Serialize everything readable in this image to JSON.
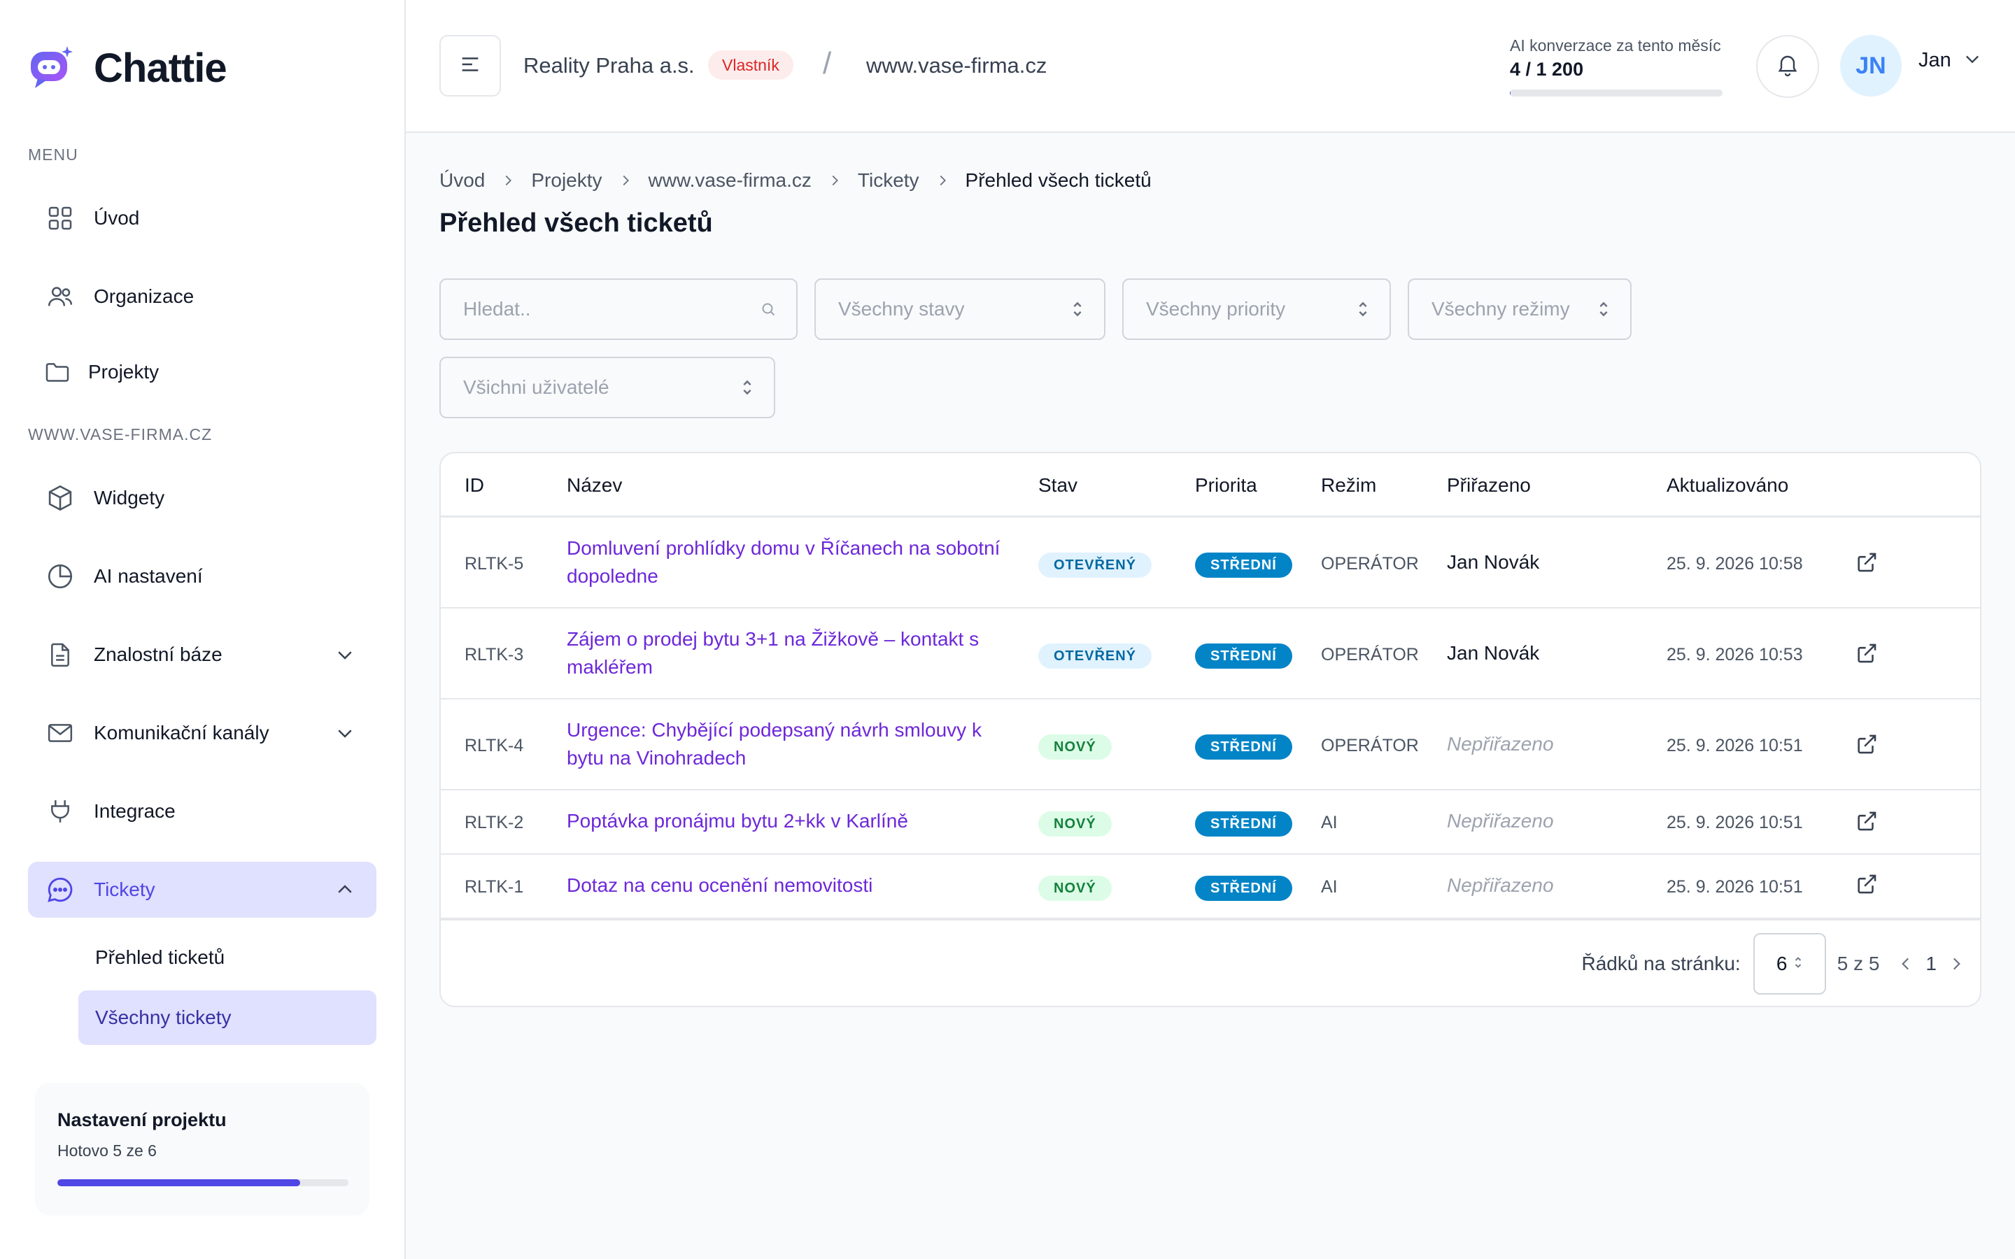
{
  "app": {
    "name": "Chattie"
  },
  "sidebar": {
    "menu_label": "MENU",
    "project_label": "WWW.VASE-FIRMA.CZ",
    "menu_items": [
      {
        "label": "Úvod",
        "icon": "dashboard-icon"
      },
      {
        "label": "Organizace",
        "icon": "users-icon"
      },
      {
        "label": "Projekty",
        "icon": "folder-icon"
      }
    ],
    "project_items": [
      {
        "label": "Widgety",
        "icon": "cube-icon"
      },
      {
        "label": "AI nastavení",
        "icon": "pie-chart-icon"
      },
      {
        "label": "Znalostní báze",
        "icon": "document-icon"
      },
      {
        "label": "Komunikační kanály",
        "icon": "mail-icon"
      },
      {
        "label": "Integrace",
        "icon": "plug-icon"
      },
      {
        "label": "Tickety",
        "icon": "chat-icon"
      }
    ],
    "tickets_sub": [
      {
        "label": "Přehled ticketů"
      },
      {
        "label": "Všechny tickety"
      }
    ],
    "setup": {
      "title": "Nastavení projektu",
      "progress_text": "Hotovo 5 ze 6",
      "progress": 0.833
    }
  },
  "header": {
    "organization": "Reality Praha a.s.",
    "role_badge": "Vlastník",
    "site": "www.vase-firma.cz",
    "ai_label": "AI konverzace za tento měsíc",
    "ai_count": "4 / 1 200",
    "ai_progress": 0.0033,
    "avatar_initials": "JN",
    "user_name": "Jan"
  },
  "breadcrumb": [
    "Úvod",
    "Projekty",
    "www.vase-firma.cz",
    "Tickety",
    "Přehled všech ticketů"
  ],
  "page": {
    "title": "Přehled všech ticketů"
  },
  "filters": {
    "search_placeholder": "Hledat..",
    "status": "Všechny stavy",
    "priority": "Všechny priority",
    "mode": "Všechny režimy",
    "users": "Všichni uživatelé"
  },
  "table": {
    "headers": [
      "ID",
      "Název",
      "Stav",
      "Priorita",
      "Režim",
      "Přiřazeno",
      "Aktualizováno"
    ],
    "rows": [
      {
        "id": "RLTK-5",
        "title": "Domluvení prohlídky domu v Říčanech na sobotní dopoledne",
        "status": "OTEVŘENÝ",
        "priority": "STŘEDNÍ",
        "mode": "OPERÁTOR",
        "assigned": "Jan Novák",
        "updated": "25. 9. 2026 10:58"
      },
      {
        "id": "RLTK-3",
        "title": "Zájem o prodej bytu 3+1 na Žižkově – kontakt s makléřem",
        "status": "OTEVŘENÝ",
        "priority": "STŘEDNÍ",
        "mode": "OPERÁTOR",
        "assigned": "Jan Novák",
        "updated": "25. 9. 2026 10:53"
      },
      {
        "id": "RLTK-4",
        "title": "Urgence: Chybějící podepsaný návrh smlouvy k bytu na Vinohradech",
        "status": "NOVÝ",
        "priority": "STŘEDNÍ",
        "mode": "OPERÁTOR",
        "assigned": "Nepřiřazeno",
        "updated": "25. 9. 2026 10:51"
      },
      {
        "id": "RLTK-2",
        "title": "Poptávka pronájmu bytu 2+kk v Karlíně",
        "status": "NOVÝ",
        "priority": "STŘEDNÍ",
        "mode": "AI",
        "assigned": "Nepřiřazeno",
        "updated": "25. 9. 2026 10:51"
      },
      {
        "id": "RLTK-1",
        "title": "Dotaz na cenu ocenění nemovitosti",
        "status": "NOVÝ",
        "priority": "STŘEDNÍ",
        "mode": "AI",
        "assigned": "Nepřiřazeno",
        "updated": "25. 9. 2026 10:51"
      }
    ]
  },
  "pagination": {
    "rows_label": "Řádků na stránku:",
    "rows_per_page": "6",
    "range": "5 z 5",
    "page": "1"
  },
  "colors": {
    "accent": "#4f46e5",
    "link": "#6d28d9",
    "priority": "#0284c7",
    "owner_badge": "#dc2626"
  }
}
